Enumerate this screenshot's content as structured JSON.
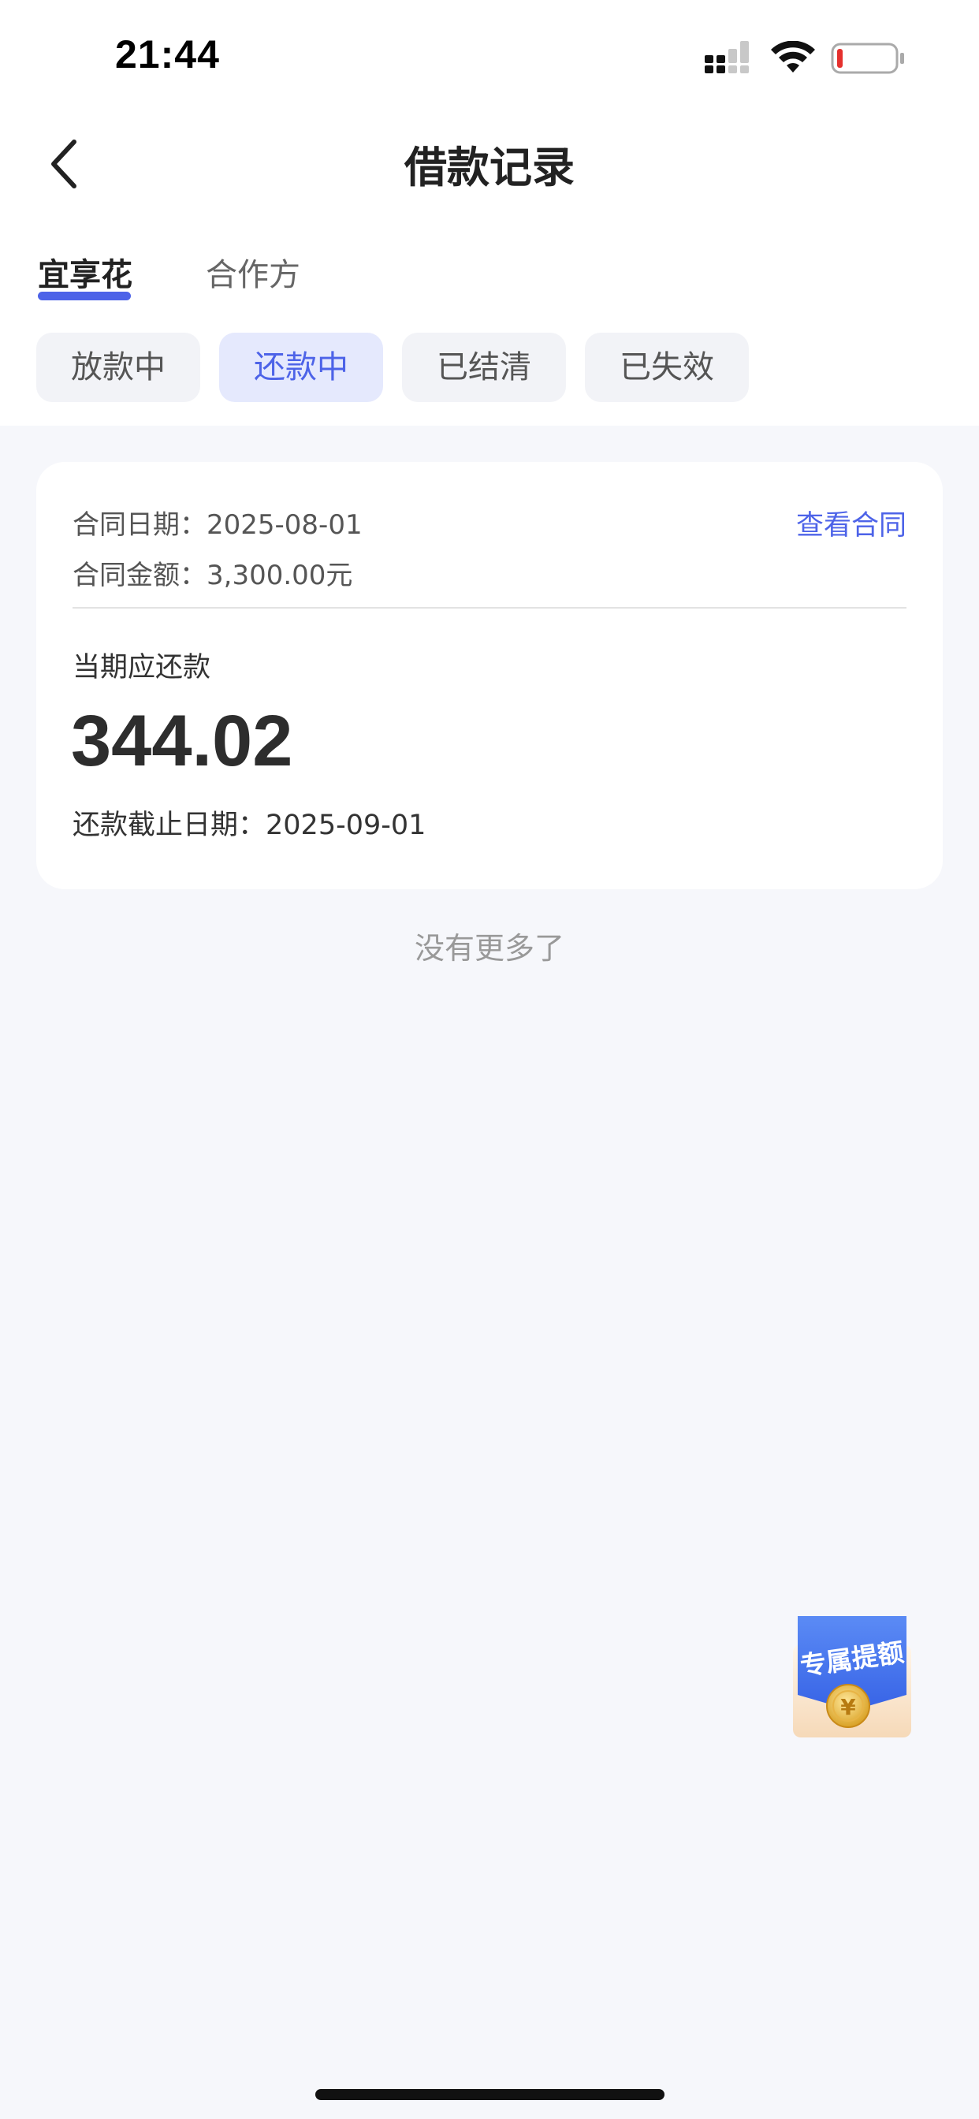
{
  "status_bar": {
    "time": "21:44",
    "icons": [
      "signal-icon",
      "wifi-icon",
      "battery-icon"
    ]
  },
  "nav": {
    "title": "借款记录",
    "back_icon": "chevron-left-icon"
  },
  "main_tabs": [
    {
      "label": "宜享花",
      "active": true
    },
    {
      "label": "合作方",
      "active": false
    }
  ],
  "filter_chips": [
    {
      "label": "放款中",
      "active": false
    },
    {
      "label": "还款中",
      "active": true
    },
    {
      "label": "已结清",
      "active": false
    },
    {
      "label": "已失效",
      "active": false
    }
  ],
  "loan_card": {
    "contract_date_label": "合同日期：",
    "contract_date": "2025-08-01",
    "contract_amount_label": "合同金额：",
    "contract_amount": "3,300.00元",
    "view_contract": "查看合同",
    "due_label": "当期应还款",
    "due_amount": "344.02",
    "deadline_label": "还款截止日期：",
    "deadline": "2025-09-01"
  },
  "list_end_text": "没有更多了",
  "floating_badge": {
    "text": "专属提额",
    "coin_symbol": "¥"
  },
  "colors": {
    "accent": "#4d63e8",
    "chip_active_bg": "#e5e9fd",
    "page_bg": "#f6f7fb"
  }
}
